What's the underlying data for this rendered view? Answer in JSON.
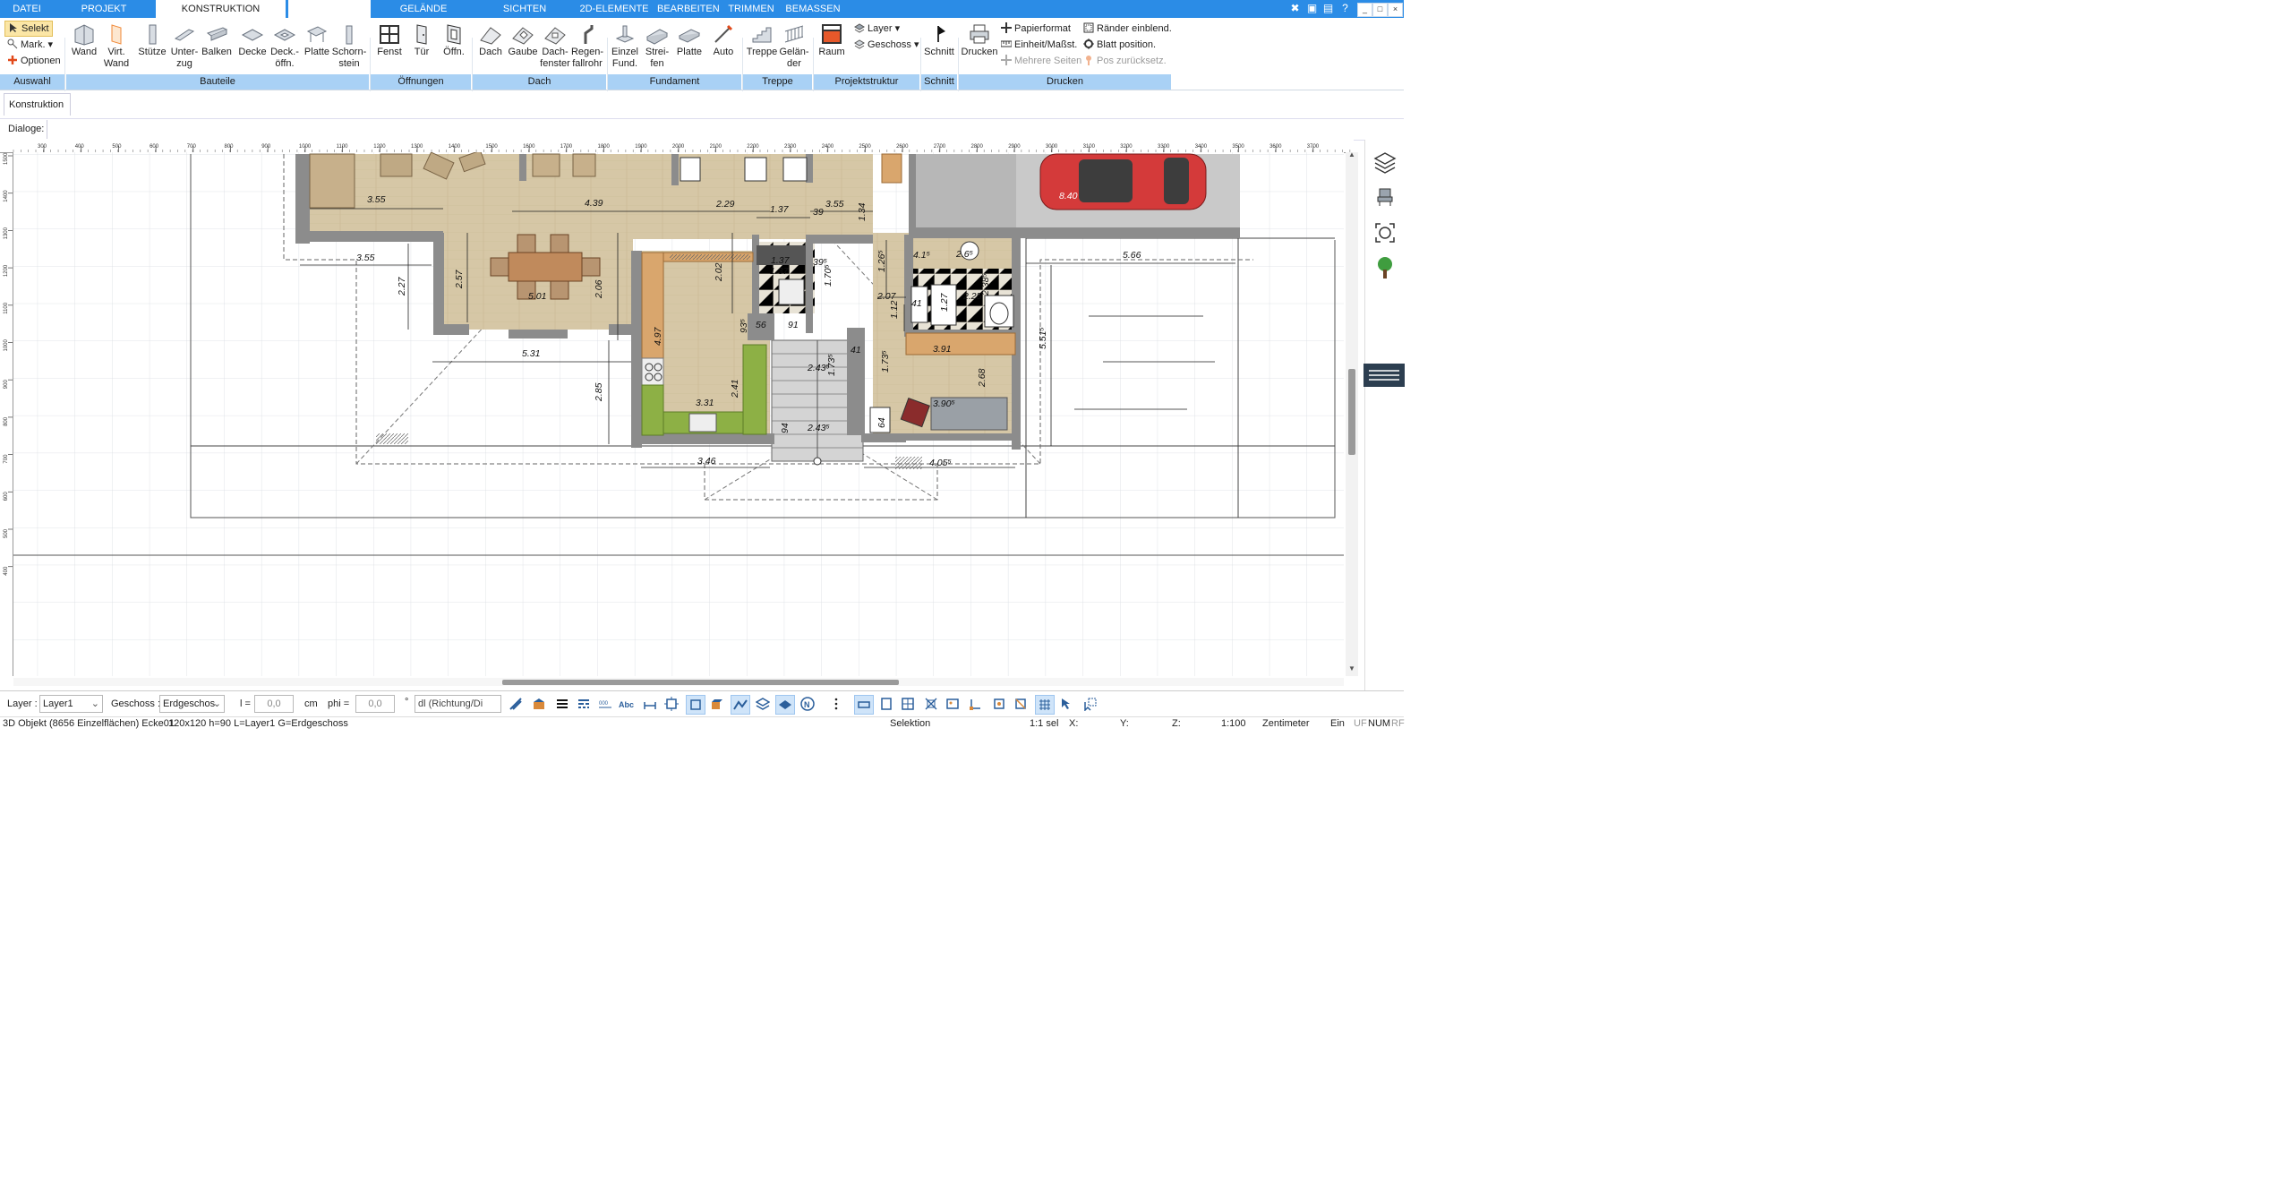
{
  "tabs": [
    {
      "label": "DATEI",
      "active": false
    },
    {
      "label": "PROJEKT",
      "active": false
    },
    {
      "label": "KONSTRUKTION",
      "active": true
    },
    {
      "label": "",
      "active": false
    },
    {
      "label": "GELÄNDE",
      "active": false
    },
    {
      "label": "SICHTEN",
      "active": false
    },
    {
      "label": "2D-ELEMENTE",
      "active": false
    },
    {
      "label": "BEARBEITEN",
      "active": false
    },
    {
      "label": "TRIMMEN",
      "active": false
    },
    {
      "label": "BEMASSEN",
      "active": false
    }
  ],
  "window_controls": [
    "_",
    "□",
    "×"
  ],
  "ribbon": {
    "auswahl": {
      "selekt": "Selekt",
      "mark": "Mark.",
      "optionen": "Optionen"
    },
    "bauteile": [
      {
        "l1": "Wand",
        "l2": ""
      },
      {
        "l1": "Virt.",
        "l2": "Wand"
      },
      {
        "l1": "Stütze",
        "l2": ""
      },
      {
        "l1": "Unter-",
        "l2": "zug"
      },
      {
        "l1": "Balken",
        "l2": ""
      },
      {
        "l1": "Decke",
        "l2": ""
      },
      {
        "l1": "Deck.-",
        "l2": "öffn."
      },
      {
        "l1": "Platte",
        "l2": ""
      },
      {
        "l1": "Schorn-",
        "l2": "stein"
      }
    ],
    "oeffnungen": [
      {
        "l1": "Fenst",
        "l2": ""
      },
      {
        "l1": "Tür",
        "l2": ""
      },
      {
        "l1": "Öffn.",
        "l2": ""
      }
    ],
    "dach": [
      {
        "l1": "Dach",
        "l2": ""
      },
      {
        "l1": "Gaube",
        "l2": ""
      },
      {
        "l1": "Dach-",
        "l2": "fenster"
      },
      {
        "l1": "Regen-",
        "l2": "fallrohr"
      }
    ],
    "fundament": [
      {
        "l1": "Einzel",
        "l2": "Fund."
      },
      {
        "l1": "Strei-",
        "l2": "fen"
      },
      {
        "l1": "Platte",
        "l2": ""
      },
      {
        "l1": "Auto",
        "l2": ""
      }
    ],
    "treppe": [
      {
        "l1": "Treppe",
        "l2": ""
      },
      {
        "l1": "Gelän-",
        "l2": "der"
      }
    ],
    "projekt": {
      "raum": "Raum",
      "layer": "Layer",
      "geschoss": "Geschoss"
    },
    "schnitt": {
      "label": "Schnitt"
    },
    "drucken": {
      "drucken": "Drucken",
      "papierformat": "Papierformat",
      "einheit": "Einheit/Maßst.",
      "mehrere": "Mehrere Seiten",
      "raender": "Ränder einblend.",
      "blatt": "Blatt position.",
      "pos": "Pos zurücksetz."
    },
    "groups": [
      "Auswahl",
      "Bauteile",
      "Öffnungen",
      "Dach",
      "Fundament",
      "Treppe",
      "Projektstruktur",
      "Schnitt",
      "Drucken"
    ]
  },
  "panel": {
    "tab": "Konstruktion",
    "dialoge": "Dialoge:"
  },
  "ruler": {
    "h": [
      "300",
      "400",
      "500",
      "600",
      "700",
      "800",
      "900",
      "1000",
      "1100",
      "1200",
      "1300",
      "1400",
      "1500",
      "1600",
      "1700",
      "1800",
      "1900",
      "2000",
      "2100",
      "2200",
      "2300",
      "2400",
      "2500",
      "2600",
      "2700",
      "2800",
      "2900",
      "3000",
      "3100",
      "3200",
      "3300",
      "3400",
      "3500",
      "3600",
      "3700"
    ],
    "v": [
      "1500",
      "1400",
      "1300",
      "1200",
      "1100",
      "1000",
      "900",
      "800",
      "700",
      "600",
      "500",
      "400"
    ]
  },
  "dimensions": [
    "3.55",
    "3.55",
    "4.39",
    "2.29",
    "1.37",
    "39",
    "3.55",
    "1.34",
    "2.57",
    "2.27",
    "5.01",
    "2.06",
    "2.02",
    "1.37",
    "1.37",
    "39⁵",
    "1.70⁵",
    "1.26⁵",
    "2.07",
    "4.1⁵",
    "2.6⁵",
    "2.38⁵",
    "2.25",
    "1.27",
    "41",
    "1.12",
    "56",
    "91",
    "93⁵",
    "41",
    "5.31",
    "4.97",
    "2.41",
    "3.31",
    "3.91",
    "1.73⁵",
    "2.43⁵",
    "1.73⁵",
    "2.68",
    "3.90⁵",
    "64",
    "2.85",
    "2.43⁵",
    "94",
    "3.46",
    "4.05⁵",
    "5.66",
    "5.51⁵",
    "8.40"
  ],
  "bottom": {
    "layer_label": "Layer :",
    "layer_value": "Layer1",
    "geschoss_label": "Geschoss :",
    "geschoss_value": "Erdgeschos",
    "l_label": "l =",
    "l_value": "0,0",
    "l_unit": "cm",
    "phi_label": "phi =",
    "phi_value": "0,0",
    "phi_unit": "°",
    "dl_value": "dl (Richtung/Di"
  },
  "status": {
    "object": "3D Objekt (8656 Einzelflächen) Ecke01",
    "dims": "120x120 h=90 L=Layer1 G=Erdgeschoss",
    "mode": "Selektion",
    "sel": "1:1 sel",
    "x": "X:",
    "y": "Y:",
    "z": "Z:",
    "scale": "1:100",
    "unit": "Zentimeter",
    "ein": "Ein",
    "uf": "UF",
    "num": "NUM",
    "rf": "RF"
  },
  "colors": {
    "accent": "#2b8ce6",
    "group_band": "#a9d1f5",
    "floor": "#d2c4a4",
    "wall": "#8c8c8c",
    "car": "#d43a3a",
    "counter": "#8db045"
  }
}
